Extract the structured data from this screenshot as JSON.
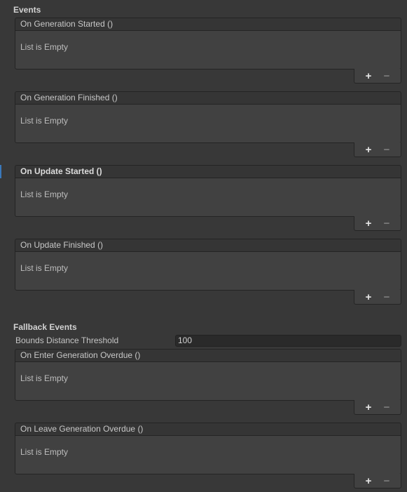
{
  "sections": {
    "events_title": "Events",
    "fallback_title": "Fallback Events"
  },
  "events": [
    {
      "header": "On Generation Started ()",
      "empty": "List is Empty"
    },
    {
      "header": "On Generation Finished ()",
      "empty": "List is Empty"
    },
    {
      "header": "On Update Started ()",
      "empty": "List is Empty"
    },
    {
      "header": "On Update Finished ()",
      "empty": "List is Empty"
    },
    {
      "header": "On Enter Generation Overdue ()",
      "empty": "List is Empty"
    },
    {
      "header": "On Leave Generation Overdue ()",
      "empty": "List is Empty"
    }
  ],
  "bounds": {
    "label": "Bounds Distance Threshold",
    "value": "100"
  },
  "buttons": {
    "add": "+",
    "remove": "−"
  },
  "colors": {
    "background": "#383838",
    "focus_accent": "#3a79bb"
  }
}
